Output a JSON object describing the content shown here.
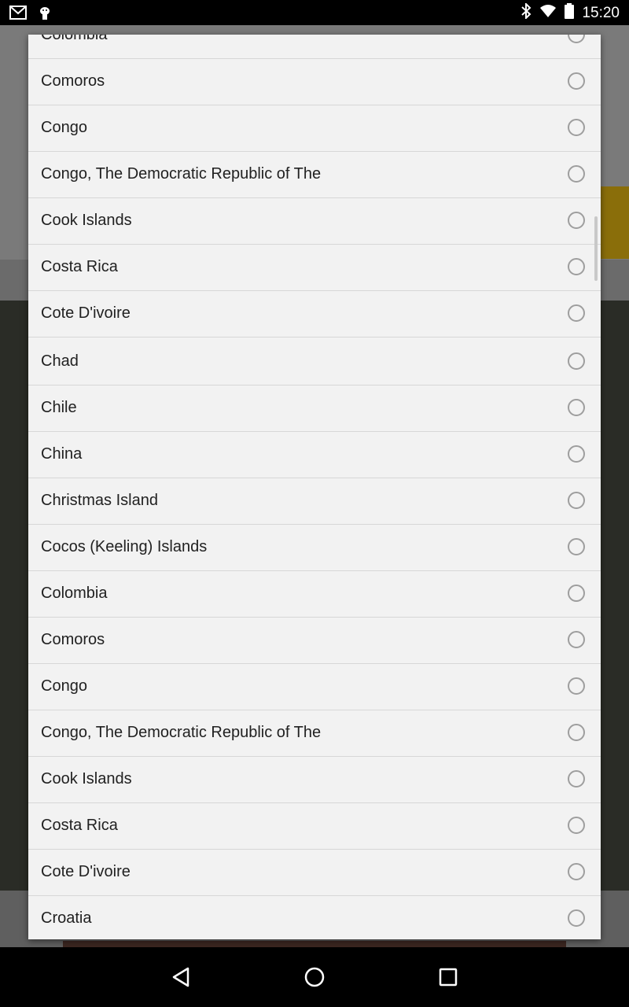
{
  "status_bar": {
    "time": "15:20",
    "icons": [
      "gmail-icon",
      "android-debug-icon",
      "bluetooth-icon",
      "wifi-icon",
      "battery-icon"
    ]
  },
  "dialog": {
    "items": [
      {
        "label": "Colombia",
        "selected": false
      },
      {
        "label": "Comoros",
        "selected": false
      },
      {
        "label": "Congo",
        "selected": false
      },
      {
        "label": "Congo, The Democratic Republic of The",
        "selected": false
      },
      {
        "label": "Cook Islands",
        "selected": false
      },
      {
        "label": "Costa Rica",
        "selected": false
      },
      {
        "label": "Cote D'ivoire",
        "selected": false
      },
      {
        "label": "Chad",
        "selected": false
      },
      {
        "label": "Chile",
        "selected": false
      },
      {
        "label": "China",
        "selected": false
      },
      {
        "label": "Christmas Island",
        "selected": false
      },
      {
        "label": "Cocos (Keeling) Islands",
        "selected": false
      },
      {
        "label": "Colombia",
        "selected": false
      },
      {
        "label": "Comoros",
        "selected": false
      },
      {
        "label": "Congo",
        "selected": false
      },
      {
        "label": "Congo, The Democratic Republic of The",
        "selected": false
      },
      {
        "label": "Cook Islands",
        "selected": false
      },
      {
        "label": "Costa Rica",
        "selected": false
      },
      {
        "label": "Cote D'ivoire",
        "selected": false
      },
      {
        "label": "Croatia",
        "selected": false
      }
    ]
  },
  "nav_bar": {
    "buttons": [
      "back-icon",
      "home-icon",
      "recents-icon"
    ]
  }
}
